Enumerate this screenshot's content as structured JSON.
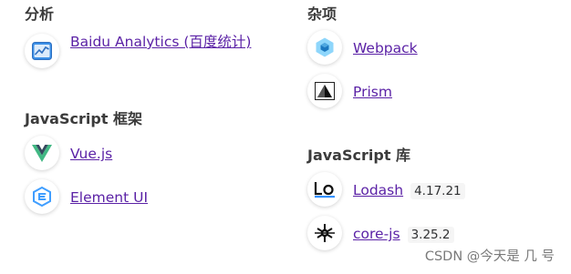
{
  "left": {
    "analytics_title": "分析",
    "analytics": [
      {
        "label": "Baidu Analytics (百度统计)",
        "icon": "baidu-analytics-icon"
      }
    ],
    "frameworks_title": "JavaScript 框架",
    "frameworks": [
      {
        "label": "Vue.js",
        "icon": "vuejs-icon"
      },
      {
        "label": "Element UI",
        "icon": "element-ui-icon"
      }
    ]
  },
  "right": {
    "misc_title": "杂项",
    "misc": [
      {
        "label": "Webpack",
        "icon": "webpack-icon"
      },
      {
        "label": "Prism",
        "icon": "prism-icon"
      }
    ],
    "libraries_title": "JavaScript 库",
    "libraries": [
      {
        "label": "Lodash",
        "version": "4.17.21",
        "icon": "lodash-icon"
      },
      {
        "label": "core-js",
        "version": "3.25.2",
        "icon": "core-js-icon"
      }
    ]
  },
  "watermark": "CSDN @今天是 几 号",
  "colors": {
    "link": "#5b22a6",
    "heading": "#3b3b3b",
    "vue_green": "#41b883",
    "vue_dark": "#35495e",
    "element_blue": "#409eff",
    "webpack_blue": "#8ed6fb",
    "lodash_blue": "#3492ff"
  }
}
